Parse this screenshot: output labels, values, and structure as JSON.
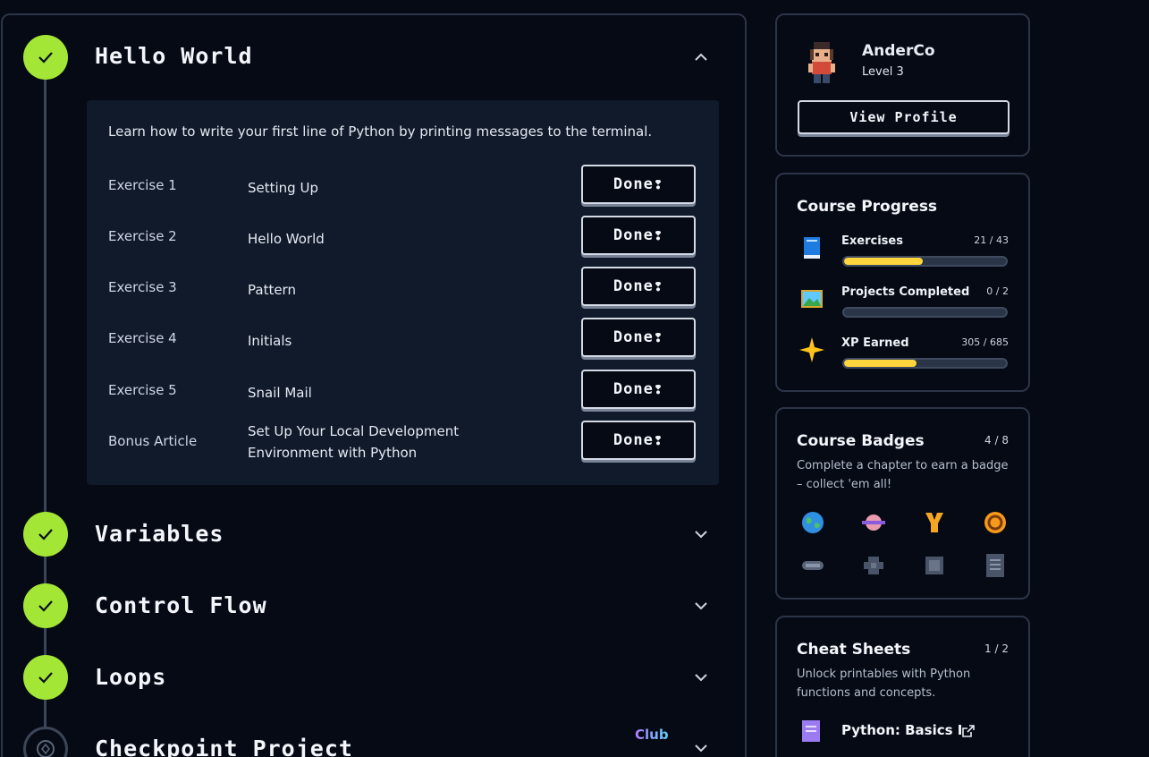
{
  "chapters": [
    {
      "title": "Hello World",
      "status": "complete",
      "expanded": true
    },
    {
      "title": "Variables",
      "status": "complete",
      "expanded": false
    },
    {
      "title": "Control Flow",
      "status": "complete",
      "expanded": false
    },
    {
      "title": "Loops",
      "status": "complete",
      "expanded": false
    },
    {
      "title": "Checkpoint Project",
      "status": "locked",
      "expanded": false,
      "tag": "Club"
    }
  ],
  "chapter_body": {
    "description": "Learn how to write your first line of Python by printing messages to the terminal.",
    "done_label": "Done❢",
    "exercises": [
      {
        "number": "Exercise 1",
        "name": "Setting Up"
      },
      {
        "number": "Exercise 2",
        "name": "Hello World"
      },
      {
        "number": "Exercise 3",
        "name": "Pattern"
      },
      {
        "number": "Exercise 4",
        "name": "Initials"
      },
      {
        "number": "Exercise 5",
        "name": "Snail Mail"
      },
      {
        "number": "Bonus Article",
        "name_line1": "Set Up Your Local Development",
        "name_line2": "Environment with Python"
      }
    ]
  },
  "profile": {
    "username": "AnderCo",
    "level": "Level 3",
    "view_profile_label": "View Profile"
  },
  "progress": {
    "title": "Course Progress",
    "items": [
      {
        "label": "Exercises",
        "value": "21 / 43",
        "fraction": 0.488,
        "icon": "book-icon"
      },
      {
        "label": "Projects Completed",
        "value": "0 / 2",
        "fraction": 0.0,
        "icon": "landscape-icon"
      },
      {
        "label": "XP Earned",
        "value": "305 / 685",
        "fraction": 0.445,
        "icon": "star-icon"
      }
    ]
  },
  "badges": {
    "title": "Course Badges",
    "count": "4 / 8",
    "subtitle": "Complete a chapter to earn a badge – collect 'em all!",
    "items": [
      {
        "icon": "globe-badge-icon",
        "earned": true
      },
      {
        "icon": "planet-badge-icon",
        "earned": true
      },
      {
        "icon": "trophy-badge-icon",
        "earned": true
      },
      {
        "icon": "loop-badge-icon",
        "earned": true
      },
      {
        "icon": "capsule-badge-icon",
        "earned": false
      },
      {
        "icon": "gear-badge-icon",
        "earned": false
      },
      {
        "icon": "chip-badge-icon",
        "earned": false
      },
      {
        "icon": "document-badge-icon",
        "earned": false
      }
    ]
  },
  "cheatsheets": {
    "title": "Cheat Sheets",
    "count": "1 / 2",
    "subtitle": "Unlock printables with Python functions and concepts.",
    "link_label": "Python: Basics I"
  },
  "colors": {
    "check_green": "#a3e635",
    "progress_yellow": "#ffd53d",
    "panel_bg": "#101a2b"
  }
}
